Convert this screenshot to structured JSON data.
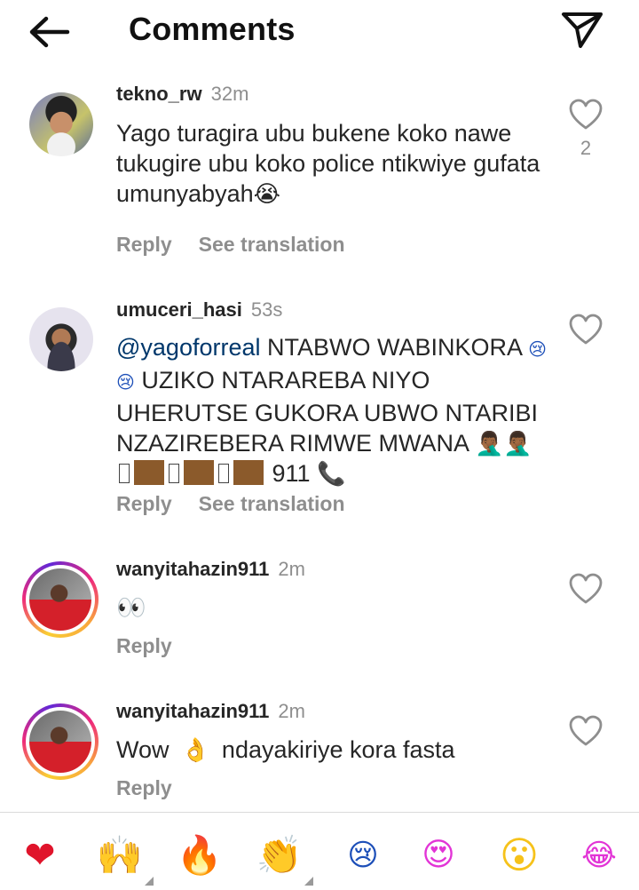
{
  "header": {
    "title": "Comments"
  },
  "labels": {
    "reply": "Reply",
    "see_translation": "See translation"
  },
  "comments": [
    {
      "username": "tekno_rw",
      "time": "32m",
      "text": "Yago turagira ubu bukene koko nawe tukugire ubu koko police ntikwiye gufata umunyabyah",
      "emoji_tail": "😭",
      "likes": "2",
      "translatable": true
    },
    {
      "username": "umuceri_hasi",
      "time": "53s",
      "mention": "@yagoforreal",
      "text": "NTABWO WABINKORA",
      "text_line2": "UZIKO NTARAREBA NIYO UHERUTSE GUKORA UBWO NTARIBI NZAZIREBERA RIMWE MWANA",
      "emoji_sad": "😢 😢",
      "emoji_facepalm": "🤦🏾‍♂️🤦🏾‍♂️",
      "tail_number": "911",
      "tail_icon": "📞",
      "translatable": true
    },
    {
      "username": "wanyitahazin911",
      "time": "2m",
      "text": "👀",
      "translatable": false
    },
    {
      "username": "wanyitahazin911",
      "time": "2m",
      "text_before": "Wow",
      "emoji": "👌",
      "text_after": "ndayakiriye kora fasta",
      "translatable": false
    }
  ],
  "emoji_bar": [
    {
      "icon": "heart-emoji",
      "glyph": "❤"
    },
    {
      "icon": "raised-hands-emoji",
      "glyph": "🙌"
    },
    {
      "icon": "fire-emoji",
      "glyph": "🔥"
    },
    {
      "icon": "clapping-hands-emoji",
      "glyph": "👏"
    },
    {
      "icon": "crying-face-emoji",
      "glyph": "😢"
    },
    {
      "icon": "heart-eyes-emoji",
      "glyph": "😍"
    },
    {
      "icon": "astonished-face-emoji",
      "glyph": "😮"
    },
    {
      "icon": "tears-of-joy-emoji",
      "glyph": "😂"
    }
  ],
  "colors": {
    "text": "#262626",
    "muted": "#8e8e8e",
    "mention": "#00376b",
    "divider": "#dbdbdb"
  }
}
